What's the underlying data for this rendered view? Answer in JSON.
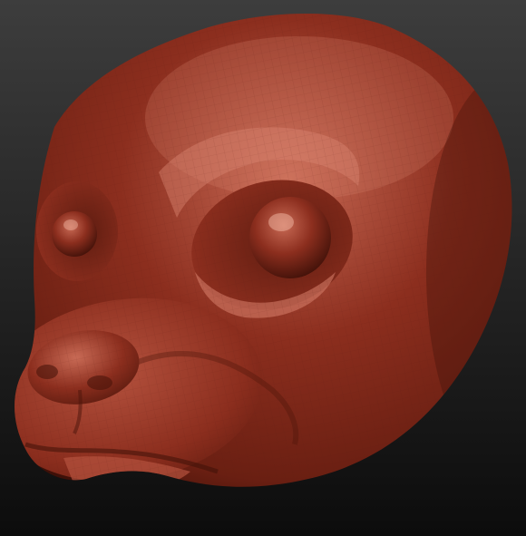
{
  "scene": {
    "subject": "sculpted-head-model",
    "colors": {
      "background_top": "#3d3d3d",
      "background_bottom": "#0c0c0c",
      "clay_base": "#8c2e1e",
      "clay_light": "#c86a55",
      "clay_dark": "#3e1008",
      "clay_highlight": "#f2b7a4",
      "wire": "#5a1a10"
    }
  }
}
